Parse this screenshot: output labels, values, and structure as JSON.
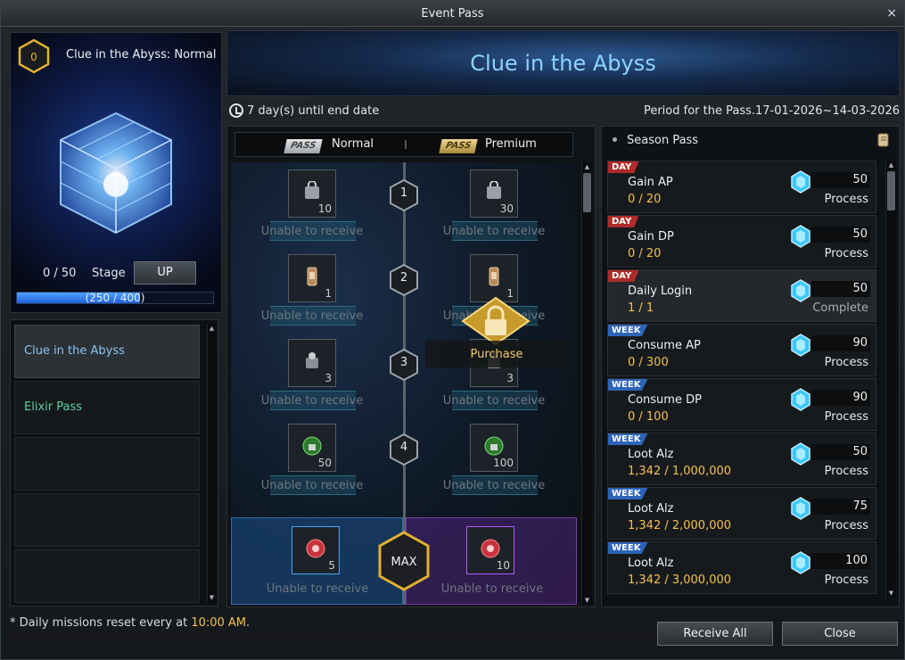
{
  "window": {
    "title": "Event Pass",
    "close_glyph": "×"
  },
  "left_panel": {
    "level_badge": "0",
    "pass_name": "Clue in the Abyss: Normal",
    "stage_count": "0 / 50",
    "stage_label": "Stage",
    "up_button": "UP",
    "exp_text": "(250 / 400)",
    "exp_fraction": 0.625,
    "list_items": [
      {
        "label": "Clue in the Abyss"
      },
      {
        "label": "Elixir Pass"
      },
      {
        "label": ""
      },
      {
        "label": ""
      },
      {
        "label": ""
      }
    ]
  },
  "banner": {
    "title": "Clue in the Abyss"
  },
  "time": {
    "days_left": "7 day(s) until end date",
    "period": "Period for the Pass.17-01-2026~14-03-2026"
  },
  "track": {
    "header": {
      "normal_tag": "PASS",
      "normal_label": "Normal",
      "premium_tag": "PASS",
      "premium_label": "Premium"
    },
    "steps": [
      {
        "step": "1",
        "normal_qty": "10",
        "premium_qty": "30",
        "normal_status": "Unable to receive",
        "premium_status": "Unable to receive"
      },
      {
        "step": "2",
        "normal_qty": "1",
        "premium_qty": "1",
        "normal_status": "Unable to receive",
        "premium_status": "Unable to receive"
      },
      {
        "step": "3",
        "normal_qty": "3",
        "premium_qty": "3",
        "normal_status": "Unable to receive",
        "premium_status": "Unable to receive"
      },
      {
        "step": "4",
        "normal_qty": "50",
        "premium_qty": "100",
        "normal_status": "Unable to receive",
        "premium_status": "Unable to receive"
      }
    ],
    "max": {
      "label": "MAX",
      "normal_qty": "5",
      "premium_qty": "10",
      "normal_status": "Unable to receive",
      "premium_status": "Unable to receive"
    },
    "purchase_label": "Purchase"
  },
  "season": {
    "title": "Season Pass",
    "missions": [
      {
        "tag": "DAY",
        "name": "Gain AP",
        "progress": "0 / 20",
        "points": "50",
        "status": "Process"
      },
      {
        "tag": "DAY",
        "name": "Gain DP",
        "progress": "0 / 20",
        "points": "50",
        "status": "Process"
      },
      {
        "tag": "DAY",
        "name": "Daily Login",
        "progress": "1 / 1",
        "points": "50",
        "status": "Complete"
      },
      {
        "tag": "WEEK",
        "name": "Consume AP",
        "progress": "0 / 300",
        "points": "90",
        "status": "Process"
      },
      {
        "tag": "WEEK",
        "name": "Consume DP",
        "progress": "0 / 100",
        "points": "90",
        "status": "Process"
      },
      {
        "tag": "WEEK",
        "name": "Loot Alz",
        "progress": "1,342 / 1,000,000",
        "points": "50",
        "status": "Process"
      },
      {
        "tag": "WEEK",
        "name": "Loot Alz",
        "progress": "1,342 / 2,000,000",
        "points": "75",
        "status": "Process"
      },
      {
        "tag": "WEEK",
        "name": "Loot Alz",
        "progress": "1,342 / 3,000,000",
        "points": "100",
        "status": "Process"
      }
    ]
  },
  "footer": {
    "note_prefix": "* Daily missions reset every at ",
    "note_time": "10:00 AM",
    "note_suffix": ".",
    "receive_all": "Receive All",
    "close": "Close"
  }
}
